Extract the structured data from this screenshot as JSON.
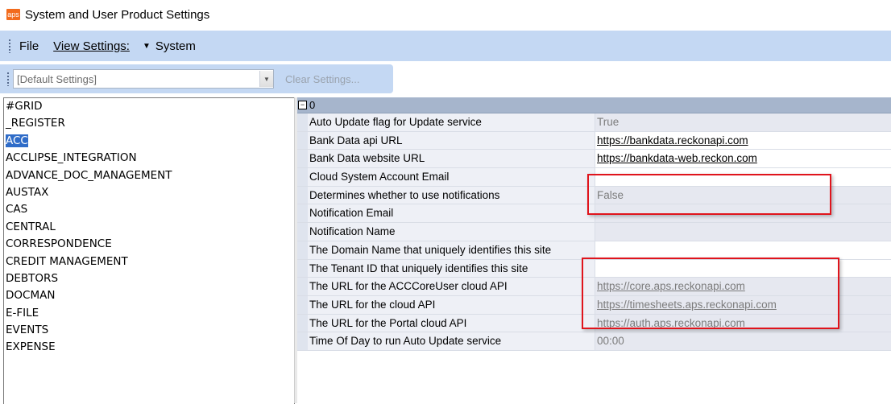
{
  "window": {
    "title": "System and User Product Settings",
    "icon_label": "aps"
  },
  "menu": {
    "file": "File",
    "view_settings": "View Settings:",
    "system": "System"
  },
  "toolbar": {
    "combo_value": "[Default Settings]",
    "clear_button": "Clear Settings..."
  },
  "modules": [
    "#GRID",
    "_REGISTER",
    "ACC",
    "ACCLIPSE_INTEGRATION",
    "ADVANCE_DOC_MANAGEMENT",
    "AUSTAX",
    "CAS",
    "CENTRAL",
    "CORRESPONDENCE",
    "CREDIT MANAGEMENT",
    "DEBTORS",
    "DOCMAN",
    "E-FILE",
    "EVENTS",
    "EXPENSE"
  ],
  "selected_module": "ACC",
  "grid": {
    "group_label": "0",
    "rows": [
      {
        "name": "Auto Update flag for Update service",
        "value": "True"
      },
      {
        "name": "Bank Data api URL",
        "value": "https://bankdata.reckonapi.com"
      },
      {
        "name": "Bank Data website URL",
        "value": "https://bankdata-web.reckon.com"
      },
      {
        "name": "Cloud System Account Email",
        "value": ""
      },
      {
        "name": "Determines whether to use notifications",
        "value": "False"
      },
      {
        "name": "Notification Email",
        "value": ""
      },
      {
        "name": "Notification Name",
        "value": ""
      },
      {
        "name": "The Domain Name that uniquely identifies this site",
        "value": ""
      },
      {
        "name": "The Tenant ID that uniquely identifies this site",
        "value": ""
      },
      {
        "name": "The URL for the ACCCoreUser cloud API",
        "value": "https://core.aps.reckonapi.com"
      },
      {
        "name": "The URL for the cloud API",
        "value": "https://timesheets.aps.reckonapi.com"
      },
      {
        "name": "The URL for the Portal cloud API",
        "value": "https://auth.aps.reckonapi.com"
      },
      {
        "name": "Time Of Day to run Auto Update service",
        "value": "00:00"
      }
    ]
  },
  "colors": {
    "highlight": "#e0141c",
    "selection": "#2f6cc8",
    "menubar": "#c4d8f3"
  }
}
